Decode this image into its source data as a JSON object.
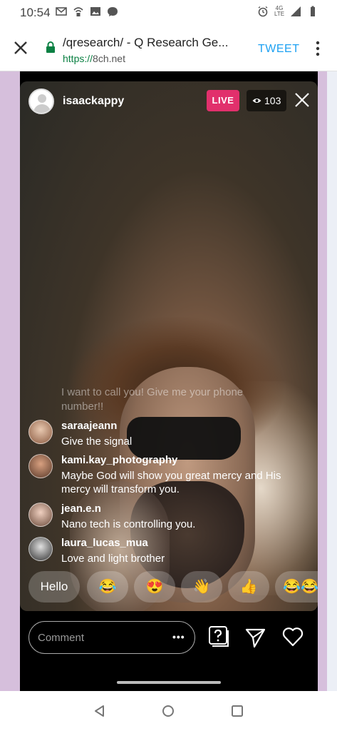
{
  "status_bar": {
    "time": "10:54",
    "network": "4G LTE"
  },
  "browser": {
    "page_title": "/qresearch/ - Q Research Ge...",
    "url_scheme": "https://",
    "url_host": "8ch.net",
    "tweet_label": "TWEET"
  },
  "live": {
    "username": "isaackappy",
    "live_label": "LIVE",
    "viewer_count": "103",
    "faded_comment": "I want to call you! Give me your phone number!!",
    "comments": [
      {
        "user": "saraajeann",
        "text": "Give the signal"
      },
      {
        "user": "kami.kay_photography",
        "text": "Maybe God will show you great mercy and His mercy will transform you."
      },
      {
        "user": "jean.e.n",
        "text": "Nano tech is controlling you."
      },
      {
        "user": "laura_lucas_mua",
        "text": "Love and light brother"
      }
    ],
    "reactions": [
      "Hello",
      "😂",
      "😍",
      "👋",
      "👍",
      "😂😂"
    ],
    "comment_placeholder": "Comment",
    "more_label": "•••"
  },
  "colors": {
    "live_badge": "#e1306c",
    "tweet": "#1da1f2",
    "https": "#0b8043",
    "page_background": "#d6bfdc"
  }
}
